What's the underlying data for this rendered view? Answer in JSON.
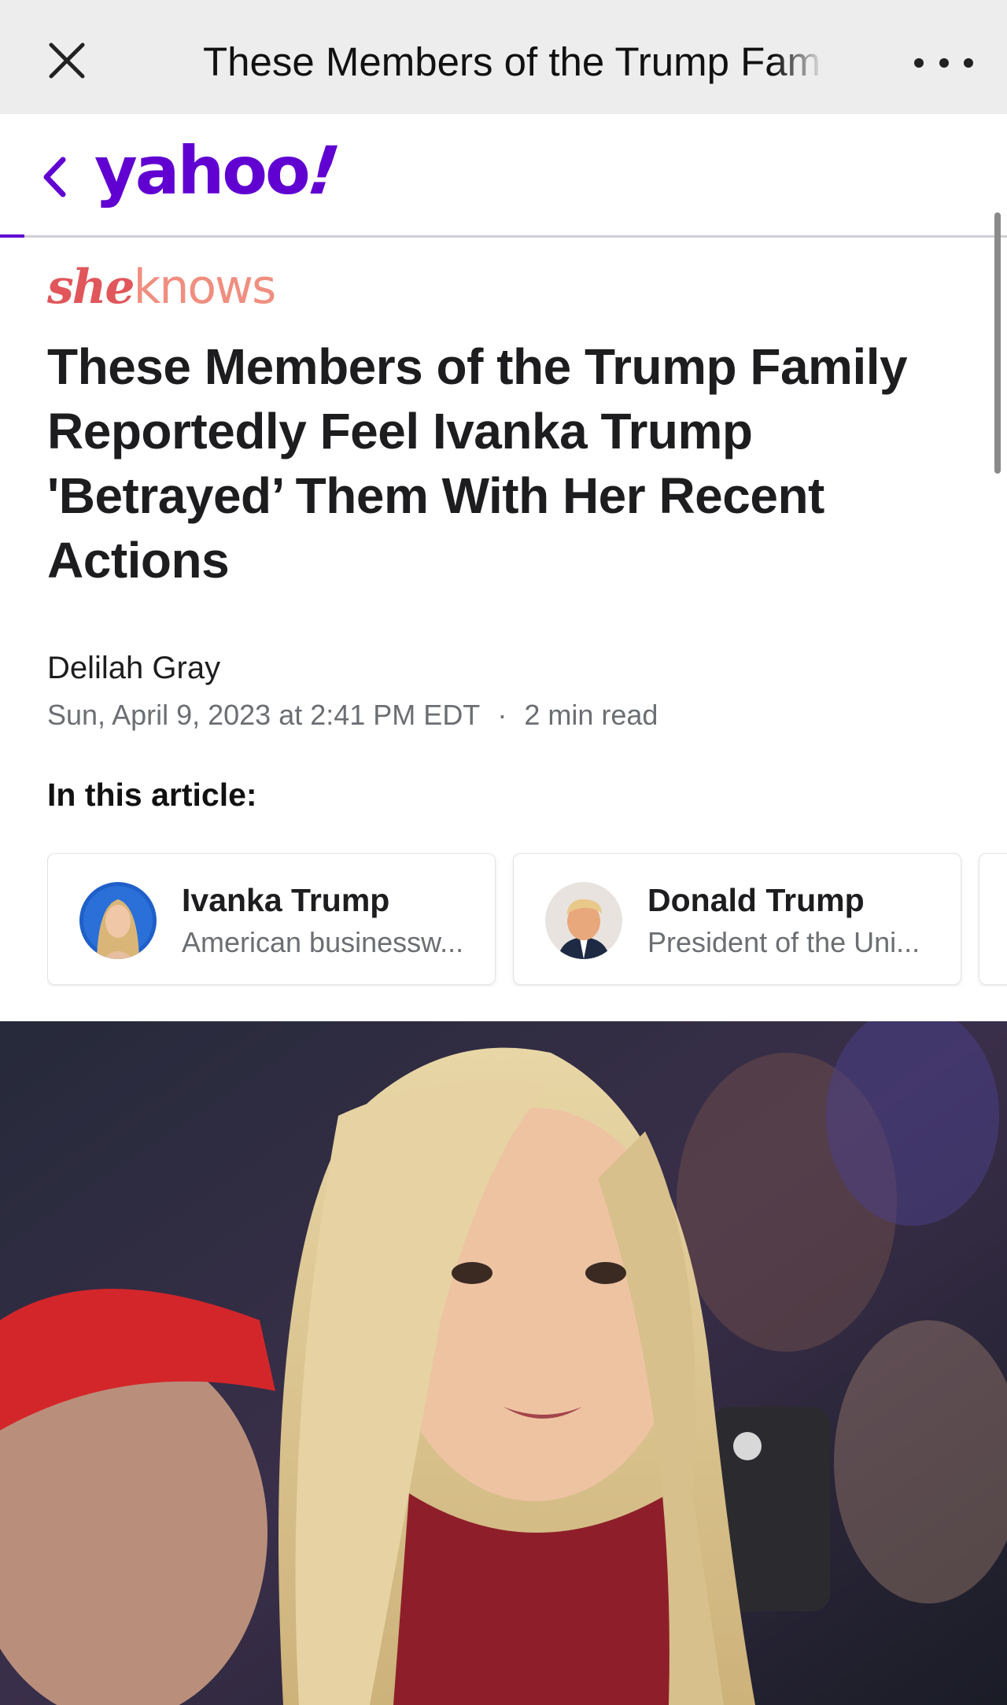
{
  "browser": {
    "page_title": "These Members of the Trump Fam"
  },
  "header": {
    "logo_text": "yahoo",
    "logo_bang": "!"
  },
  "article": {
    "publisher_she": "she",
    "publisher_knows": "knows",
    "headline": "These Members of the Trump Family Reportedly Feel Ivanka Trump 'Betrayed’ Them With Her Recent Actions",
    "author": "Delilah Gray",
    "date": "Sun, April 9, 2023 at 2:41 PM EDT",
    "separator": "·",
    "read_time": "2 min read",
    "in_this_article": "In this article:"
  },
  "entities": [
    {
      "name": "Ivanka Trump",
      "description": "American businessw..."
    },
    {
      "name": "Donald Trump",
      "description": "President of the Uni..."
    }
  ],
  "colors": {
    "yahoo_purple": "#6001d2",
    "sheknows_red": "#e0565a",
    "chrome_bg": "#ededed"
  },
  "icons": {
    "close": "close-icon",
    "more": "more-dots-icon",
    "back": "chevron-left-icon"
  }
}
